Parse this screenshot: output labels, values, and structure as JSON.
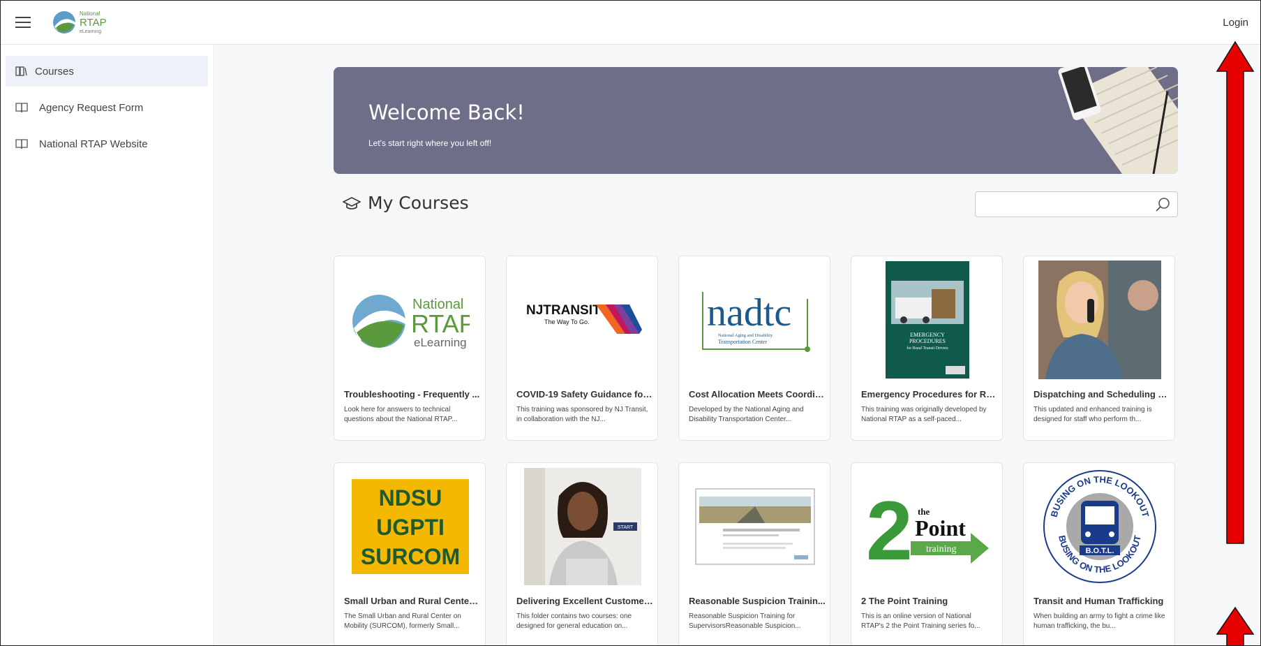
{
  "topbar": {
    "login_label": "Login",
    "logo_text": {
      "line1": "National",
      "line2": "RTAP",
      "line3": "eLearning"
    }
  },
  "sidebar": {
    "items": [
      {
        "label": "Courses",
        "icon": "courses-icon",
        "active": true
      },
      {
        "label": "Agency Request Form",
        "icon": "book-icon",
        "active": false
      },
      {
        "label": "National RTAP Website",
        "icon": "book-icon",
        "active": false
      }
    ]
  },
  "banner": {
    "title": "Welcome Back!",
    "subtitle": "Let's start right where you left off!"
  },
  "my_courses": {
    "title": "My Courses",
    "search_value": "",
    "courses": [
      {
        "title": "Troubleshooting - Frequently ...",
        "desc": "Look here for answers to technical questions about the National RTAP...",
        "thumb": "National RTAP eLearning logo"
      },
      {
        "title": "COVID-19 Safety Guidance for ...",
        "desc": "This training was sponsored by NJ Transit, in collaboration with the NJ...",
        "thumb": "NJ Transit logo"
      },
      {
        "title": "Cost Allocation Meets Coordin...",
        "desc": "Developed by the National Aging and Disability Transportation Center...",
        "thumb": "NADTC logo"
      },
      {
        "title": "Emergency Procedures for Ru...",
        "desc": "This training was originally developed by National RTAP as a self-paced...",
        "thumb": "Emergency procedures cover"
      },
      {
        "title": "Dispatching and Scheduling Tr...",
        "desc": "This updated and enhanced training is designed for staff who perform th...",
        "thumb": "Dispatcher photo"
      },
      {
        "title": "Small Urban and Rural Center ...",
        "desc": "The Small Urban and Rural Center on Mobility (SURCOM), formerly Small...",
        "thumb": "NDSU UGPTI SURCOM"
      },
      {
        "title": "Delivering Excellent Customer...",
        "desc": "This folder contains two courses: one designed for general education on...",
        "thumb": "Customer service photo"
      },
      {
        "title": "Reasonable Suspicion Trainin...",
        "desc": "Reasonable Suspicion Training for SupervisorsReasonable Suspicion...",
        "thumb": "Reasonable suspicion screenshot"
      },
      {
        "title": "2 The Point Training",
        "desc": "This is an online version of National RTAP's 2 the Point Training series fo...",
        "thumb": "2 the Point training logo"
      },
      {
        "title": "Transit and Human Trafficking",
        "desc": "When building an army to fight a crime like human trafficking, the bu...",
        "thumb": "Busing on the Lookout logo"
      }
    ]
  },
  "thumb_text": {
    "rtap": {
      "l1": "National",
      "l2": "RTAP",
      "l3": "eLearning"
    },
    "nj": {
      "brand": "NJTRANSIT",
      "tag": "The Way To Go."
    },
    "nadtc": {
      "brand": "nadtc",
      "l1": "National Aging and Disability",
      "l2": "Transportation Center"
    },
    "emerg": {
      "l1": "EMERGENCY",
      "l2": "PROCEDURES",
      "l3": "for Rural Transit Drivers"
    },
    "surcom": {
      "l1": "NDSU",
      "l2": "UGPTI",
      "l3": "SURCOM"
    },
    "start": "START",
    "point": {
      "two": "2",
      "the": "the",
      "point": "Point",
      "training": "training"
    },
    "botl": {
      "top": "BUSING ON THE LOOKOUT",
      "mid": "B.O.T.L.",
      "bottom": "BUSING ON THE LOOKOUT"
    }
  },
  "colors": {
    "banner": "#6e6e88",
    "annotation_arrow": "#e60000",
    "sidebar_active": "#eef2f8"
  }
}
